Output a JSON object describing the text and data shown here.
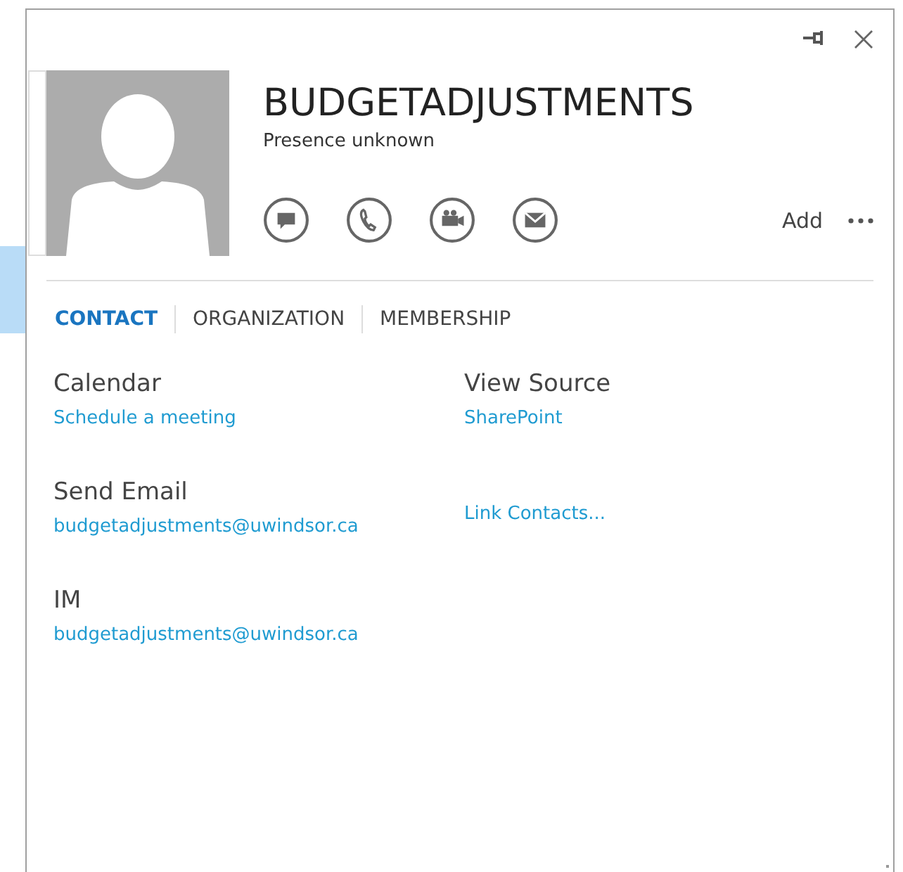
{
  "contact": {
    "name": "BUDGETADJUSTMENTS",
    "presence": "Presence unknown"
  },
  "actions": [
    {
      "kind": "im"
    },
    {
      "kind": "call"
    },
    {
      "kind": "video"
    },
    {
      "kind": "email"
    }
  ],
  "add": "Add",
  "tabs": [
    {
      "label": "CONTACT",
      "selected": true
    },
    {
      "label": "ORGANIZATION",
      "selected": false
    },
    {
      "label": "MEMBERSHIP",
      "selected": false
    }
  ],
  "left_fields": [
    {
      "label": "Calendar",
      "link": "Schedule a meeting"
    },
    {
      "label": "Send Email",
      "link": "budgetadjustments@uwindsor.ca"
    },
    {
      "label": "IM",
      "link": "budgetadjustments@uwindsor.ca"
    }
  ],
  "right_fields": [
    {
      "label": "View Source",
      "link": "SharePoint"
    },
    {
      "link": "Link Contacts..."
    }
  ]
}
